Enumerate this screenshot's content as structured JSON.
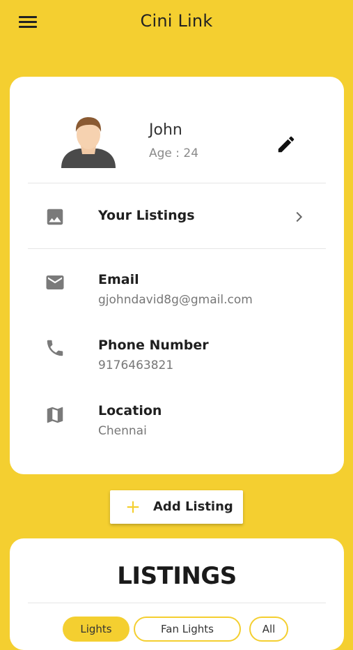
{
  "app": {
    "title": "Cini Link"
  },
  "profile": {
    "name": "John",
    "age": "Age : 24"
  },
  "listings_row": {
    "label": "Your Listings"
  },
  "contact": {
    "email_label": "Email",
    "email_value": "gjohndavid8g@gmail.com",
    "phone_label": "Phone Number",
    "phone_value": "9176463821",
    "location_label": "Location",
    "location_value": "Chennai"
  },
  "actions": {
    "add_listing": "Add Listing"
  },
  "listings": {
    "title": "LISTINGS",
    "chips": [
      "Lights",
      "Fan Lights",
      "All"
    ]
  },
  "colors": {
    "accent": "#f4cf30",
    "icon_gray": "#7a7a7a"
  }
}
